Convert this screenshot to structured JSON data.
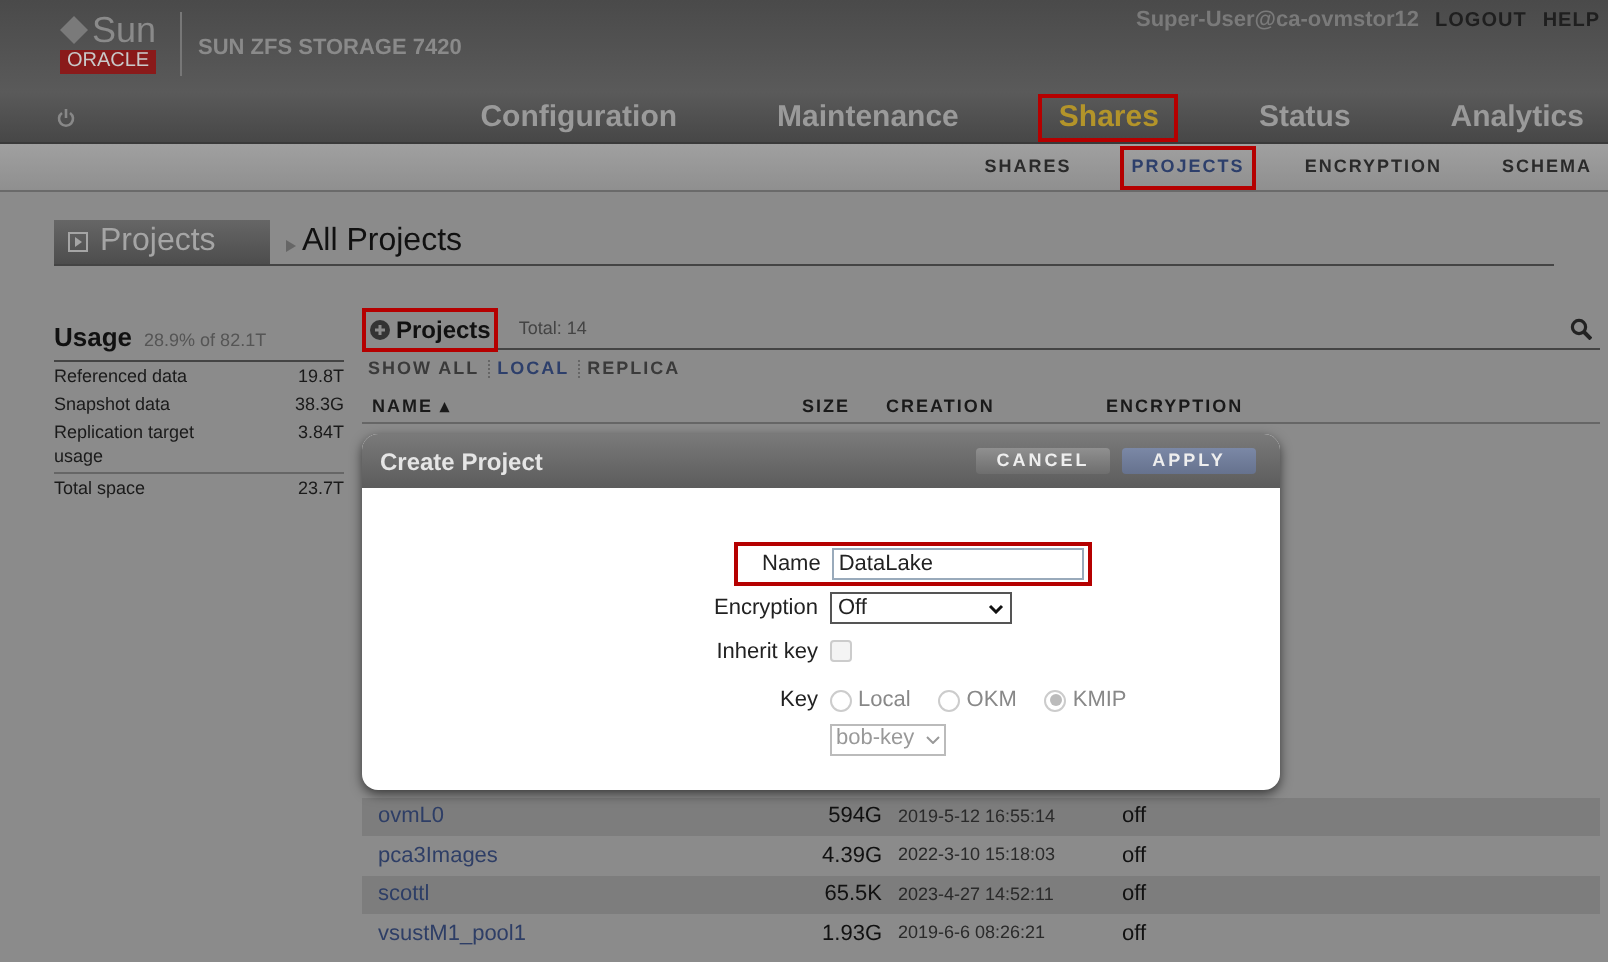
{
  "brand": {
    "logo": "Sun",
    "oracle": "ORACLE",
    "product": "SUN ZFS STORAGE 7420"
  },
  "user": {
    "name": "Super-User@ca-ovmstor12",
    "links": [
      "LOGOUT",
      "HELP"
    ]
  },
  "nav_tabs": [
    {
      "label": "Configuration",
      "selected": false,
      "highlighted": false
    },
    {
      "label": "Maintenance",
      "selected": false,
      "highlighted": false
    },
    {
      "label": "Shares",
      "selected": true,
      "highlighted": true
    },
    {
      "label": "Status",
      "selected": false,
      "highlighted": false
    },
    {
      "label": "Analytics",
      "selected": false,
      "highlighted": false
    }
  ],
  "sub_tabs": [
    {
      "label": "SHARES",
      "selected": false,
      "highlighted": false
    },
    {
      "label": "PROJECTS",
      "selected": true,
      "highlighted": true
    },
    {
      "label": "ENCRYPTION",
      "selected": false,
      "highlighted": false
    },
    {
      "label": "SCHEMA",
      "selected": false,
      "highlighted": false
    }
  ],
  "breadcrumb": {
    "panel": "Projects",
    "current": "All Projects"
  },
  "usage": {
    "title": "Usage",
    "summary": "28.9% of 82.1T",
    "rows": [
      {
        "label": "Referenced data",
        "value": "19.8T"
      },
      {
        "label": "Snapshot data",
        "value": "38.3G"
      },
      {
        "label": "Replication target usage",
        "value": "3.84T"
      },
      {
        "label": "Total space",
        "value": "23.7T"
      }
    ]
  },
  "projects": {
    "title": "Projects",
    "highlighted": true,
    "total": "Total: 14",
    "filters": [
      {
        "label": "SHOW ALL",
        "selected": false
      },
      {
        "label": "LOCAL",
        "selected": true
      },
      {
        "label": "REPLICA",
        "selected": false
      }
    ],
    "columns": [
      "NAME ▴",
      "SIZE",
      "CREATION",
      "ENCRYPTION"
    ],
    "rows": [
      {
        "name": "ovmL0",
        "size": "594G",
        "creation": "2019-5-12 16:55:14",
        "encryption": "off"
      },
      {
        "name": "pca3Images",
        "size": "4.39G",
        "creation": "2022-3-10 15:18:03",
        "encryption": "off"
      },
      {
        "name": "scottl",
        "size": "65.5K",
        "creation": "2023-4-27 14:52:11",
        "encryption": "off"
      },
      {
        "name": "vsustM1_pool1",
        "size": "1.93G",
        "creation": "2019-6-6 08:26:21",
        "encryption": "off"
      }
    ]
  },
  "dialog": {
    "title": "Create Project",
    "buttons": [
      "CANCEL",
      "APPLY"
    ],
    "name_label": "Name",
    "name_value": "DataLake",
    "name_highlighted": true,
    "encryption_label": "Encryption",
    "encryption_value": "Off",
    "inherit_label": "Inherit key",
    "inherit_checked": false,
    "inherit_disabled": true,
    "key_label": "Key",
    "key_options": [
      {
        "label": "Local",
        "selected": false
      },
      {
        "label": "OKM",
        "selected": false
      },
      {
        "label": "KMIP",
        "selected": true
      }
    ],
    "key_disabled": true,
    "key_value": "bob-key"
  }
}
